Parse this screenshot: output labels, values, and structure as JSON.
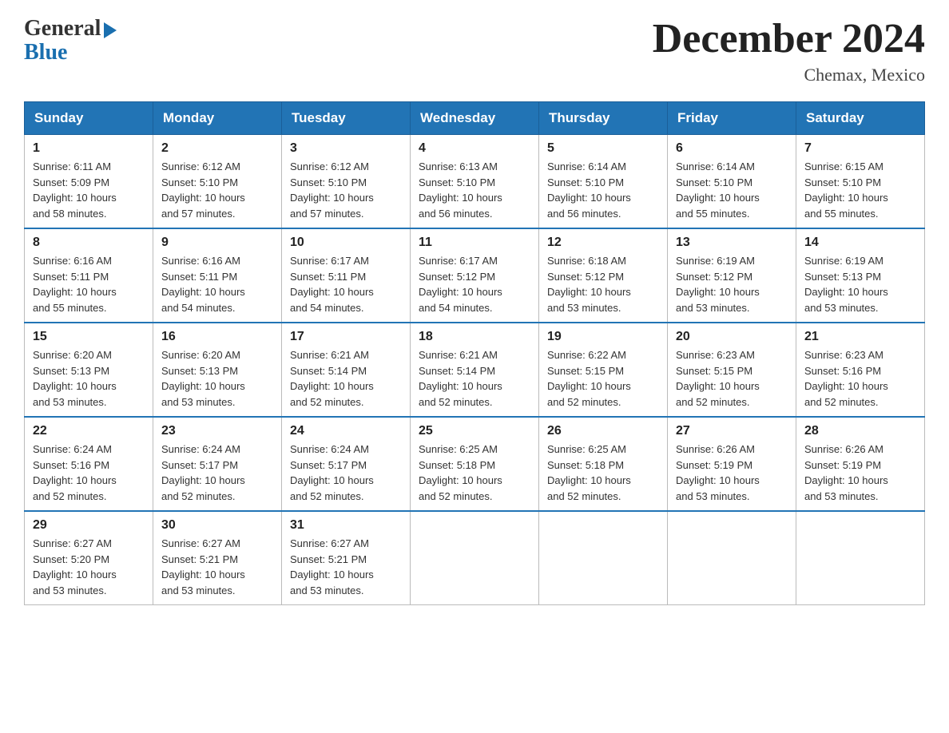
{
  "header": {
    "logo_general": "General",
    "logo_blue": "Blue",
    "month_title": "December 2024",
    "location": "Chemax, Mexico"
  },
  "days_of_week": [
    "Sunday",
    "Monday",
    "Tuesday",
    "Wednesday",
    "Thursday",
    "Friday",
    "Saturday"
  ],
  "weeks": [
    [
      {
        "day": "1",
        "sunrise": "6:11 AM",
        "sunset": "5:09 PM",
        "daylight": "10 hours and 58 minutes."
      },
      {
        "day": "2",
        "sunrise": "6:12 AM",
        "sunset": "5:10 PM",
        "daylight": "10 hours and 57 minutes."
      },
      {
        "day": "3",
        "sunrise": "6:12 AM",
        "sunset": "5:10 PM",
        "daylight": "10 hours and 57 minutes."
      },
      {
        "day": "4",
        "sunrise": "6:13 AM",
        "sunset": "5:10 PM",
        "daylight": "10 hours and 56 minutes."
      },
      {
        "day": "5",
        "sunrise": "6:14 AM",
        "sunset": "5:10 PM",
        "daylight": "10 hours and 56 minutes."
      },
      {
        "day": "6",
        "sunrise": "6:14 AM",
        "sunset": "5:10 PM",
        "daylight": "10 hours and 55 minutes."
      },
      {
        "day": "7",
        "sunrise": "6:15 AM",
        "sunset": "5:10 PM",
        "daylight": "10 hours and 55 minutes."
      }
    ],
    [
      {
        "day": "8",
        "sunrise": "6:16 AM",
        "sunset": "5:11 PM",
        "daylight": "10 hours and 55 minutes."
      },
      {
        "day": "9",
        "sunrise": "6:16 AM",
        "sunset": "5:11 PM",
        "daylight": "10 hours and 54 minutes."
      },
      {
        "day": "10",
        "sunrise": "6:17 AM",
        "sunset": "5:11 PM",
        "daylight": "10 hours and 54 minutes."
      },
      {
        "day": "11",
        "sunrise": "6:17 AM",
        "sunset": "5:12 PM",
        "daylight": "10 hours and 54 minutes."
      },
      {
        "day": "12",
        "sunrise": "6:18 AM",
        "sunset": "5:12 PM",
        "daylight": "10 hours and 53 minutes."
      },
      {
        "day": "13",
        "sunrise": "6:19 AM",
        "sunset": "5:12 PM",
        "daylight": "10 hours and 53 minutes."
      },
      {
        "day": "14",
        "sunrise": "6:19 AM",
        "sunset": "5:13 PM",
        "daylight": "10 hours and 53 minutes."
      }
    ],
    [
      {
        "day": "15",
        "sunrise": "6:20 AM",
        "sunset": "5:13 PM",
        "daylight": "10 hours and 53 minutes."
      },
      {
        "day": "16",
        "sunrise": "6:20 AM",
        "sunset": "5:13 PM",
        "daylight": "10 hours and 53 minutes."
      },
      {
        "day": "17",
        "sunrise": "6:21 AM",
        "sunset": "5:14 PM",
        "daylight": "10 hours and 52 minutes."
      },
      {
        "day": "18",
        "sunrise": "6:21 AM",
        "sunset": "5:14 PM",
        "daylight": "10 hours and 52 minutes."
      },
      {
        "day": "19",
        "sunrise": "6:22 AM",
        "sunset": "5:15 PM",
        "daylight": "10 hours and 52 minutes."
      },
      {
        "day": "20",
        "sunrise": "6:23 AM",
        "sunset": "5:15 PM",
        "daylight": "10 hours and 52 minutes."
      },
      {
        "day": "21",
        "sunrise": "6:23 AM",
        "sunset": "5:16 PM",
        "daylight": "10 hours and 52 minutes."
      }
    ],
    [
      {
        "day": "22",
        "sunrise": "6:24 AM",
        "sunset": "5:16 PM",
        "daylight": "10 hours and 52 minutes."
      },
      {
        "day": "23",
        "sunrise": "6:24 AM",
        "sunset": "5:17 PM",
        "daylight": "10 hours and 52 minutes."
      },
      {
        "day": "24",
        "sunrise": "6:24 AM",
        "sunset": "5:17 PM",
        "daylight": "10 hours and 52 minutes."
      },
      {
        "day": "25",
        "sunrise": "6:25 AM",
        "sunset": "5:18 PM",
        "daylight": "10 hours and 52 minutes."
      },
      {
        "day": "26",
        "sunrise": "6:25 AM",
        "sunset": "5:18 PM",
        "daylight": "10 hours and 52 minutes."
      },
      {
        "day": "27",
        "sunrise": "6:26 AM",
        "sunset": "5:19 PM",
        "daylight": "10 hours and 53 minutes."
      },
      {
        "day": "28",
        "sunrise": "6:26 AM",
        "sunset": "5:19 PM",
        "daylight": "10 hours and 53 minutes."
      }
    ],
    [
      {
        "day": "29",
        "sunrise": "6:27 AM",
        "sunset": "5:20 PM",
        "daylight": "10 hours and 53 minutes."
      },
      {
        "day": "30",
        "sunrise": "6:27 AM",
        "sunset": "5:21 PM",
        "daylight": "10 hours and 53 minutes."
      },
      {
        "day": "31",
        "sunrise": "6:27 AM",
        "sunset": "5:21 PM",
        "daylight": "10 hours and 53 minutes."
      },
      null,
      null,
      null,
      null
    ]
  ],
  "labels": {
    "sunrise_prefix": "Sunrise: ",
    "sunset_prefix": "Sunset: ",
    "daylight_prefix": "Daylight: "
  }
}
